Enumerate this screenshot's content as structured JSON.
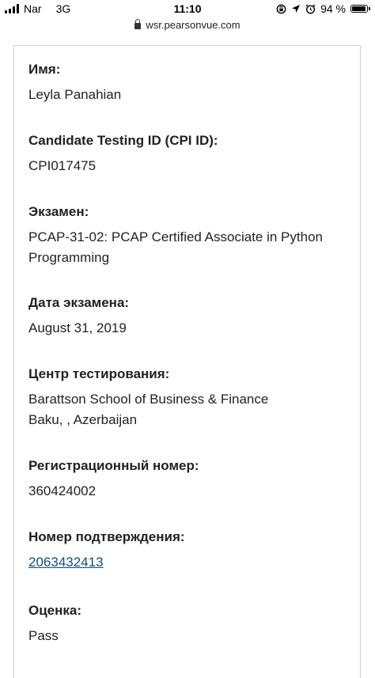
{
  "status_bar": {
    "carrier": "Nar",
    "network": "3G",
    "time": "11:10",
    "battery": "94 %",
    "battery_level": 0.94,
    "icons": [
      "signal-icon",
      "screen-lock-rotation-icon",
      "location-icon",
      "alarm-icon",
      "battery-icon"
    ]
  },
  "browser": {
    "url": "wsr.pearsonvue.com"
  },
  "fields": [
    {
      "label": "Имя:",
      "value": "Leyla Panahian"
    },
    {
      "label": "Candidate Testing ID (CPI ID):",
      "value": "CPI017475"
    },
    {
      "label": "Экзамен:",
      "value_line1": "PCAP-31-02: PCAP Certified Associate in Python",
      "value_line2": "Programming"
    },
    {
      "label": "Дата экзамена:",
      "value": "August 31, 2019"
    },
    {
      "label": "Центр тестирования:",
      "value_line1": "Barattson School of Business & Finance",
      "value_line2": "Baku, , Azerbaijan"
    },
    {
      "label": "Регистрационный номер:",
      "value": "360424002"
    },
    {
      "label": "Номер подтверждения:",
      "value": "2063432413"
    },
    {
      "label": "Оценка:",
      "value": "Pass"
    }
  ],
  "colors": {
    "link": "#0b4f8a",
    "text": "#222222",
    "border": "#d3d3d3"
  }
}
